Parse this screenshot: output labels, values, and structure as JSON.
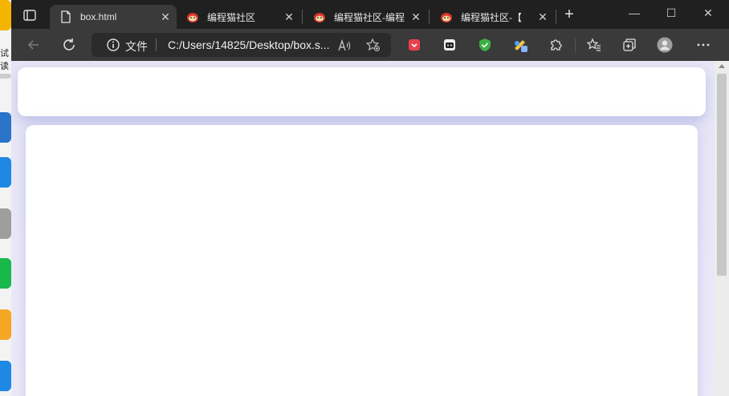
{
  "desktop": {
    "partial_text": "试读"
  },
  "tabs": [
    {
      "label": "box.html",
      "active": true,
      "icon": "file-icon"
    },
    {
      "label": "编程猫社区",
      "active": false,
      "icon": "codemao-icon"
    },
    {
      "label": "编程猫社区-编程",
      "active": false,
      "icon": "codemao-icon"
    },
    {
      "label": "编程猫社区-【",
      "active": false,
      "icon": "codemao-icon"
    }
  ],
  "window_controls": {
    "minimize": "—",
    "maximize": "☐",
    "close": "✕"
  },
  "address": {
    "protocol_label": "文件",
    "url": "C:/Users/14825/Desktop/box.s..."
  },
  "colors": {
    "tab_bg": "#202020",
    "toolbar_bg": "#3a3a3a",
    "page_bg": "#e6e6f6",
    "card": "#ffffff",
    "card_shadow": "#a0a0dc"
  }
}
